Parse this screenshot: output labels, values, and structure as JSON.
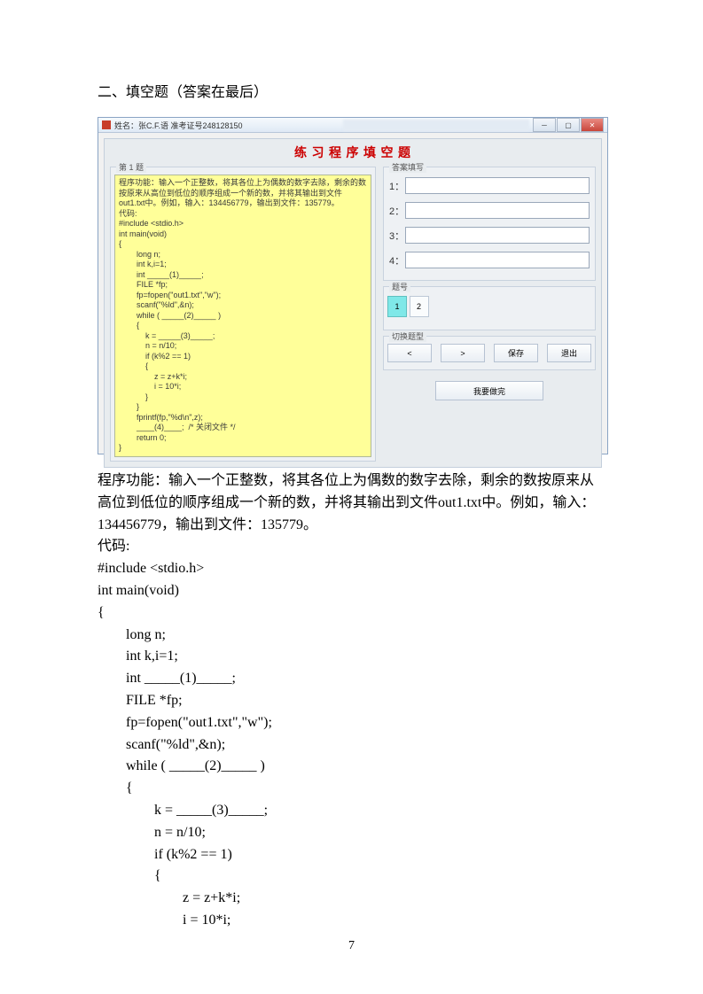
{
  "section_title": "二、填空题（答案在最后）",
  "app": {
    "titlebar": "姓名：张C.F.语  准考证号248128150",
    "banner": "练 习      程 序 填 空 题",
    "left_group_label": "第 1 题",
    "code_area": "程序功能：输入一个正整数，将其各位上为偶数的数字去除，剩余的数\n按原来从高位到低位的顺序组成一个新的数，并将其输出到文件\nout1.txt中。例如，输入：134456779，输出到文件：135779。\n代码:\n#include <stdio.h>\nint main(void)\n{\n        long n;\n        int k,i=1;\n        int _____(1)_____;\n        FILE *fp;\n        fp=fopen(\"out1.txt\",\"w\");\n        scanf(\"%ld\",&n);\n        while ( _____(2)_____ )\n        {\n            k = _____(3)_____;\n            n = n/10;\n            if (k%2 == 1)\n            {\n                z = z+k*i;\n                i = 10*i;\n            }\n        }\n        fprintf(fp,\"%d\\n\",z);\n        ____(4)____;  /* 关闭文件 */\n        return 0;\n}",
    "answers_label": "答案填写",
    "ans_labels": [
      "1：",
      "2：",
      "3：",
      "4："
    ],
    "nums_label": "题号",
    "num_buttons": [
      "1",
      "2"
    ],
    "nav_label": "切换题型",
    "nav_buttons": [
      "<",
      ">",
      "保存",
      "退出"
    ],
    "submit_label": "我要做完"
  },
  "body": {
    "para": "程序功能：输入一个正整数，将其各位上为偶数的数字去除，剩余的数按原来从高位到低位的顺序组成一个新的数，并将其输出到文件out1.txt中。例如，输入：134456779，输出到文件：135779。",
    "label_code": "代码:",
    "code": "#include <stdio.h>\nint main(void)\n{\n        long n;\n        int k,i=1;\n        int _____(1)_____;\n        FILE *fp;\n        fp=fopen(\"out1.txt\",\"w\");\n        scanf(\"%ld\",&n);\n        while ( _____(2)_____ )\n        {\n                k = _____(3)_____;\n                n = n/10;\n                if (k%2 == 1)\n                {\n                        z = z+k*i;\n                        i = 10*i;"
  },
  "page_number": "7"
}
